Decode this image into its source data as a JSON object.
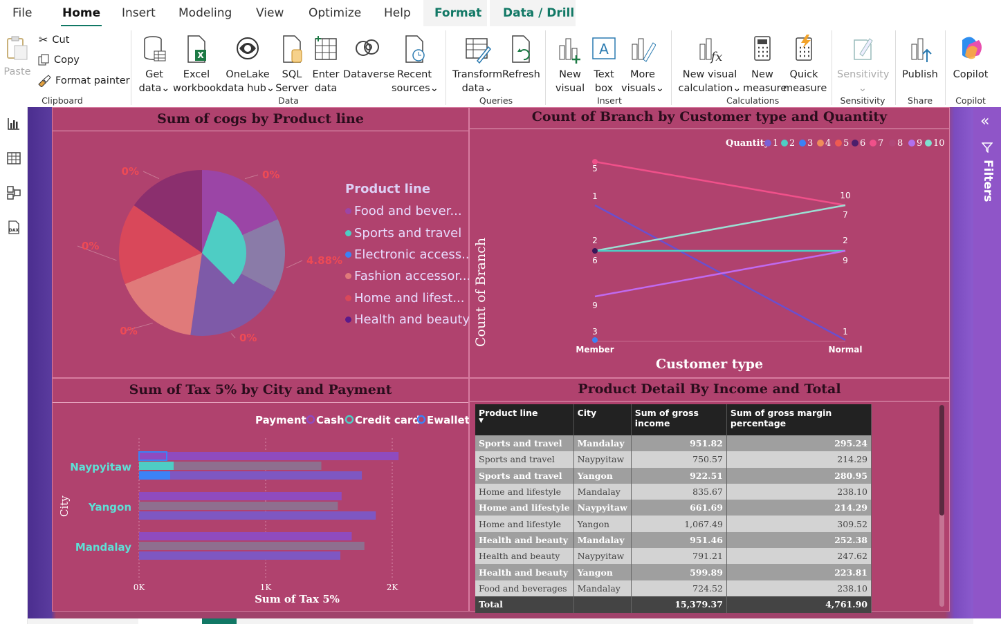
{
  "menu": {
    "items": [
      "File",
      "Home",
      "Insert",
      "Modeling",
      "View",
      "Optimize",
      "Help"
    ],
    "context": [
      "Format",
      "Data / Drill"
    ]
  },
  "ribbon": {
    "paste": "Paste",
    "cut": "Cut",
    "copy": "Copy",
    "format_painter": "Format painter",
    "get_data": [
      "Get",
      "data"
    ],
    "excel": [
      "Excel",
      "workbook"
    ],
    "onelake": [
      "OneLake",
      "data hub"
    ],
    "sql": [
      "SQL",
      "Server"
    ],
    "enter": [
      "Enter",
      "data"
    ],
    "dataverse": "Dataverse",
    "recent": [
      "Recent",
      "sources"
    ],
    "transform": [
      "Transform",
      "data"
    ],
    "refresh": "Refresh",
    "new_visual": [
      "New",
      "visual"
    ],
    "text_box": [
      "Text",
      "box"
    ],
    "more_visuals": [
      "More",
      "visuals"
    ],
    "new_visual_calc": [
      "New visual",
      "calculation"
    ],
    "new_measure": [
      "New",
      "measure"
    ],
    "quick_measure": [
      "Quick",
      "measure"
    ],
    "sensitivity": "Sensitivity",
    "publish": "Publish",
    "copilot": "Copilot",
    "groups": {
      "clipboard": "Clipboard",
      "data": "Data",
      "queries": "Queries",
      "insert": "Insert",
      "calculations": "Calculations",
      "sensitivity": "Sensitivity",
      "share": "Share",
      "copilot": "Copilot"
    }
  },
  "filters_pane": {
    "label": "Filters"
  },
  "colors": {
    "canvas": "#a0426b",
    "panel": "#b0426e",
    "accent": "#117865",
    "food": "#9b45a6",
    "sports": "#4ecdc4",
    "electronic": "#8a7ba8",
    "fashion": "#e07a7a",
    "home": "#d9485a",
    "health": "#8b2f6e",
    "cash": "#8e4bbf",
    "credit": "#8e6f8f",
    "ewallet": "#7e57c2"
  },
  "pie_chart": {
    "title": "Sum of cogs by Product line",
    "legend_title": "Product line",
    "chart_data": {
      "type": "pie",
      "categories": [
        "Food and bever...",
        "Sports and travel",
        "Electronic access...",
        "Fashion accessor...",
        "Home and lifest...",
        "Health and beauty"
      ],
      "values": [
        0.0,
        4.88,
        0.0,
        0.0,
        0.0,
        0.0
      ],
      "labels": [
        "0%",
        "4.88%",
        "0%",
        "0%",
        "0%",
        "0%"
      ]
    }
  },
  "line_chart": {
    "title": "Count of Branch by Customer type and Quantity",
    "legend_title": "Quantity",
    "xlabel": "Customer type",
    "ylabel": "Count of Branch",
    "chart_data": {
      "type": "line",
      "x": [
        "Member",
        "Normal"
      ],
      "legend": [
        "1",
        "2",
        "3",
        "4",
        "5",
        "6",
        "7",
        "8",
        "9",
        "10"
      ],
      "series": [
        {
          "name": "5",
          "values": [
            5,
            10
          ]
        },
        {
          "name": "1",
          "values": [
            1,
            1
          ]
        },
        {
          "name": "2",
          "values": [
            2,
            2
          ]
        },
        {
          "name": "6",
          "values": [
            6,
            7
          ]
        },
        {
          "name": "9",
          "values": [
            9,
            9
          ]
        },
        {
          "name": "3",
          "values": [
            3,
            null
          ]
        }
      ],
      "point_labels": {
        "Member": [
          "5",
          "1",
          "2",
          "6",
          "9",
          "3"
        ],
        "Normal": [
          "10",
          "7",
          "2",
          "9",
          "1"
        ]
      }
    }
  },
  "bar_chart": {
    "title": "Sum of Tax 5% by City and Payment",
    "legend_title": "Payment",
    "xlabel": "Sum of Tax 5%",
    "ylabel": "City",
    "chart_data": {
      "type": "bar",
      "categories": [
        "Naypyitaw",
        "Yangon",
        "Mandalay"
      ],
      "series": [
        {
          "name": "Cash",
          "values": [
            2050,
            1600,
            1680
          ]
        },
        {
          "name": "Credit card",
          "values": [
            1440,
            1570,
            1780
          ]
        },
        {
          "name": "Ewallet",
          "values": [
            1760,
            1870,
            1590
          ]
        }
      ],
      "ticks": [
        "0K",
        "1K",
        "2K"
      ],
      "xlim": [
        0,
        2200
      ]
    }
  },
  "table": {
    "title": "Product Detail By Income and Total",
    "columns": [
      "Product line",
      "City",
      "Sum of gross income",
      "Sum of gross margin percentage"
    ],
    "rows": [
      [
        "Sports and travel",
        "Mandalay",
        "951.82",
        "295.24"
      ],
      [
        "Sports and travel",
        "Naypyitaw",
        "750.57",
        "214.29"
      ],
      [
        "Sports and travel",
        "Yangon",
        "922.51",
        "280.95"
      ],
      [
        "Home and lifestyle",
        "Mandalay",
        "835.67",
        "238.10"
      ],
      [
        "Home and lifestyle",
        "Naypyitaw",
        "661.69",
        "214.29"
      ],
      [
        "Home and lifestyle",
        "Yangon",
        "1,067.49",
        "309.52"
      ],
      [
        "Health and beauty",
        "Mandalay",
        "951.46",
        "252.38"
      ],
      [
        "Health and beauty",
        "Naypyitaw",
        "791.21",
        "247.62"
      ],
      [
        "Health and beauty",
        "Yangon",
        "599.89",
        "223.81"
      ],
      [
        "Food and beverages",
        "Mandalay",
        "724.52",
        "238.10"
      ]
    ],
    "total": [
      "Total",
      "",
      "15,379.37",
      "4,761.90"
    ]
  }
}
